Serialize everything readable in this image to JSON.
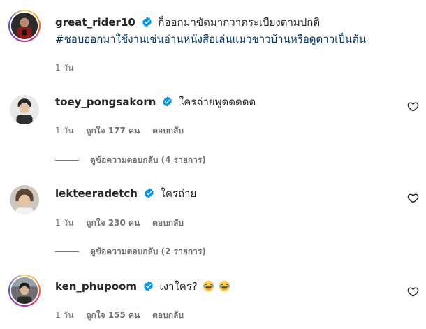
{
  "post": {
    "username": "great_rider10",
    "caption": "ก็ออกมาขัดมากวาดระเบียงตามปกติ",
    "hashtag": "#ชอบออกมาใช้งานเช่นอ่านหนังสือเล่นแมวชาวบ้านหรือดูดาวเป็นต้น",
    "time": "1 วัน"
  },
  "comments": [
    {
      "username": "toey_pongsakorn",
      "text": "ใครถ่ายพูดดดดด",
      "time": "1 วัน",
      "likes": "ถูกใจ 177 คน",
      "reply_label": "ตอบกลับ",
      "view_replies": "ดูข้อความตอบกลับ (4 รายการ)"
    },
    {
      "username": "lekteeradetch",
      "text": "ใครถ่าย",
      "time": "1 วัน",
      "likes": "ถูกใจ 230 คน",
      "reply_label": "ตอบกลับ",
      "view_replies": "ดูข้อความตอบกลับ (2 รายการ)"
    },
    {
      "username": "ken_phupoom",
      "text": "เงาใคร?",
      "time": "1 วัน",
      "likes": "ถูกใจ 155 คน",
      "reply_label": "ตอบกลับ"
    }
  ],
  "icons": {
    "verified": "verified-badge-icon",
    "like": "heart-outline-icon",
    "emoji": "laughing-tears-emoji"
  },
  "colors": {
    "verified_blue": "#0095f6",
    "hashtag": "#00376b",
    "meta_gray": "#737373"
  }
}
